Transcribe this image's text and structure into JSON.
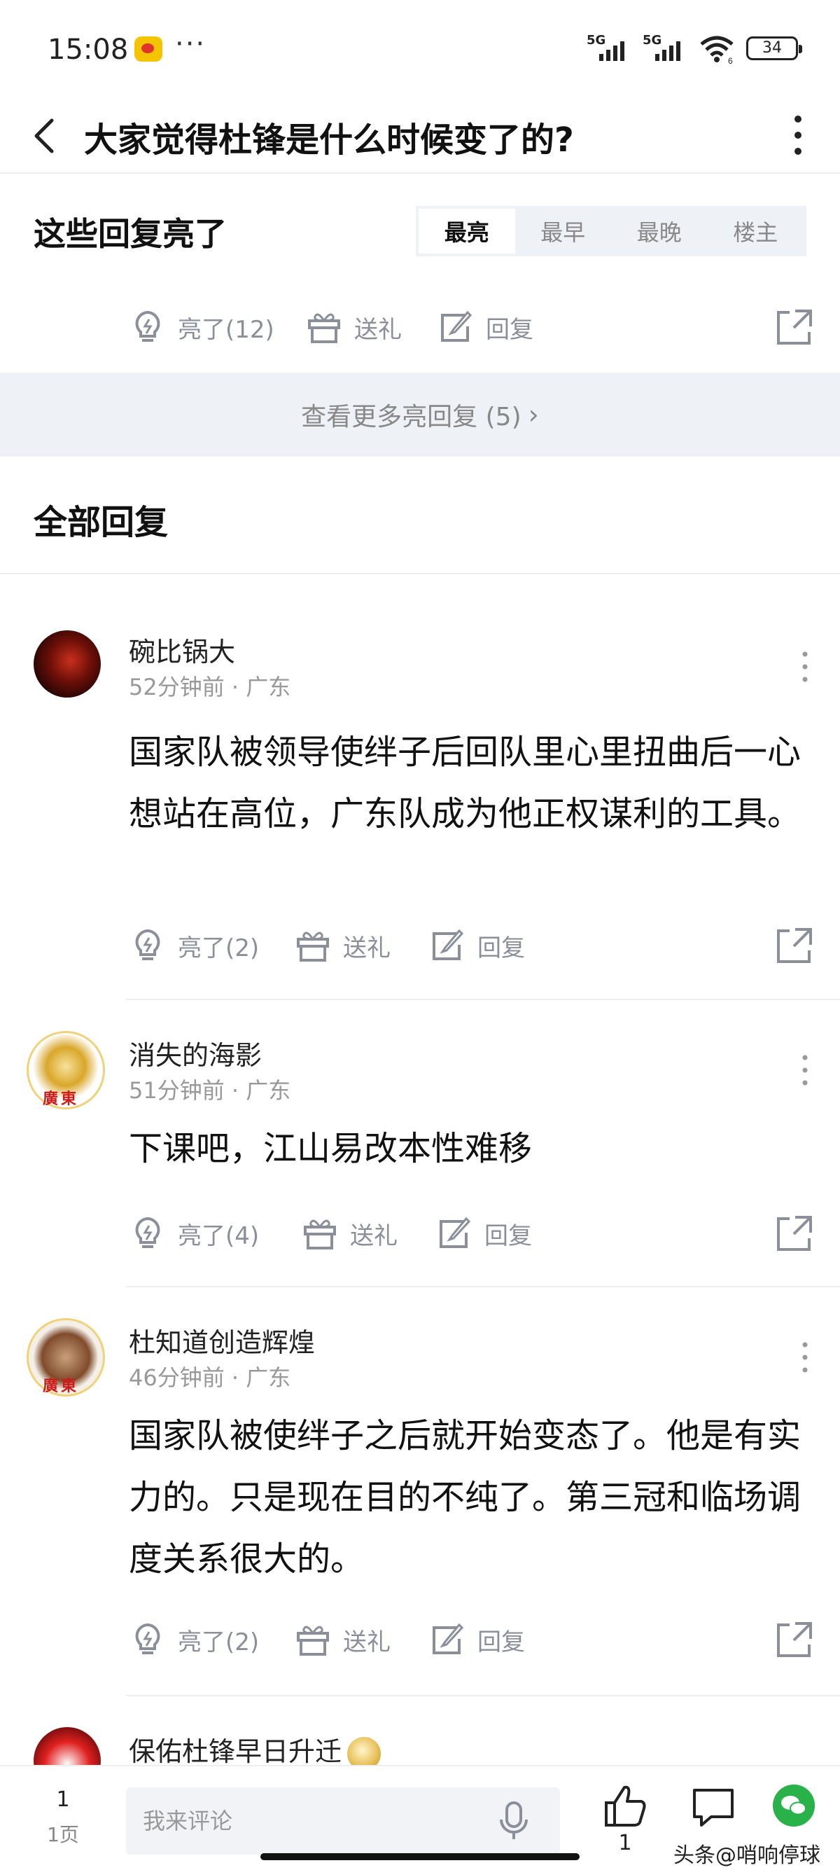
{
  "status_bar": {
    "time": "15:08",
    "dots": "···",
    "signal_1": "5G",
    "signal_2": "5G",
    "wifi_sub": "6",
    "battery": "34"
  },
  "header": {
    "title": "大家觉得杜锋是什么时候变了的?"
  },
  "highlight": {
    "title": "这些回复亮了",
    "tabs": [
      "最亮",
      "最早",
      "最晚",
      "楼主"
    ],
    "active_tab": "最亮",
    "actions": {
      "bright": "亮了(12)",
      "gift": "送礼",
      "reply": "回复"
    },
    "more_link": "查看更多亮回复 (5)"
  },
  "all_replies_title": "全部回复",
  "comments": [
    {
      "name": "碗比锅大",
      "time": "52分钟前",
      "location": "广东",
      "text": "国家队被领导使绊子后回队里心里扭曲后一心想站在高位，广东队成为他正权谋利的工具。",
      "bright": "亮了(2)",
      "gift": "送礼",
      "reply": "回复"
    },
    {
      "name": "消失的海影",
      "time": "51分钟前",
      "location": "广东",
      "avatar_text": "廣東",
      "text": "下课吧，江山易改本性难移",
      "bright": "亮了(4)",
      "gift": "送礼",
      "reply": "回复"
    },
    {
      "name": "杜知道创造辉煌",
      "time": "46分钟前",
      "location": "广东",
      "avatar_text": "廣東",
      "text": "国家队被使绊子之后就开始变态了。他是有实力的。只是现在目的不纯了。第三冠和临场调度关系很大的。",
      "bright": "亮了(2)",
      "gift": "送礼",
      "reply": "回复"
    },
    {
      "name": "保佑杜锋早日升迁"
    }
  ],
  "meta_separator": "·",
  "bottom_bar": {
    "page_number": "1",
    "page_label": "1页",
    "comment_placeholder": "我来评论",
    "like_count": "1",
    "watermark": "头条@哨响停球"
  },
  "colors": {
    "accent_gray": "#8a8f99",
    "tab_bg": "#eef1f6",
    "more_bg": "#eef1f5",
    "wechat_green": "#2ab24a"
  },
  "icons": [
    "back-icon",
    "more-vertical-icon",
    "bulb-icon",
    "gift-icon",
    "edit-icon",
    "share-icon",
    "mic-icon",
    "thumbs-up-icon",
    "chat-bubble-icon",
    "wechat-icon"
  ]
}
